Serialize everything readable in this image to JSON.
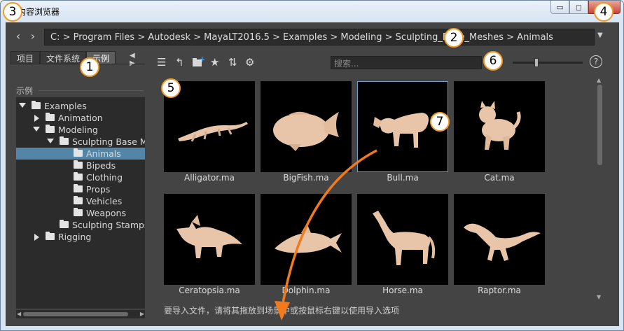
{
  "window": {
    "title": "内容浏览器",
    "buttons": {
      "minimize": "▭",
      "restore": "◻",
      "close": "✕"
    }
  },
  "pathbar": {
    "back_icon": "‹",
    "forward_icon": "›",
    "path": "C:  >  Program Files  >  Autodesk  >  MayaLT2016.5  >  Examples  >  Modeling  >  Sculpting_Base_Meshes  >  Animals",
    "dropdown_icon": "▼"
  },
  "left_panel": {
    "tabs": [
      {
        "label": "项目"
      },
      {
        "label": "文件系统"
      },
      {
        "label": "示例",
        "active": true
      }
    ],
    "tab_arrows": "◀ ▶",
    "section_title": "示例",
    "tree": [
      {
        "label": "Examples",
        "level": 0,
        "expanded": true
      },
      {
        "label": "Animation",
        "level": 1,
        "expanded": false
      },
      {
        "label": "Modeling",
        "level": 1,
        "expanded": true
      },
      {
        "label": "Sculpting Base Meshes",
        "level": 2,
        "expanded": true
      },
      {
        "label": "Animals",
        "level": 3,
        "selected": true
      },
      {
        "label": "Bipeds",
        "level": 3
      },
      {
        "label": "Clothing",
        "level": 3
      },
      {
        "label": "Props",
        "level": 3
      },
      {
        "label": "Vehicles",
        "level": 3
      },
      {
        "label": "Weapons",
        "level": 3
      },
      {
        "label": "Sculpting Stamps",
        "level": 2
      },
      {
        "label": "Rigging",
        "level": 0,
        "expanded": false
      }
    ]
  },
  "toolbar": {
    "icons": [
      "list-view-icon",
      "go-up-icon",
      "new-folder-icon",
      "bookmark-star-icon",
      "sort-icon",
      "settings-gear-icon"
    ],
    "search_placeholder": "搜索...",
    "zoom_level": 0.35,
    "help_label": "?"
  },
  "files": [
    {
      "name": "Alligator.ma"
    },
    {
      "name": "BigFish.ma"
    },
    {
      "name": "Bull.ma",
      "selected": true
    },
    {
      "name": "Cat.ma"
    },
    {
      "name": "Ceratopsia.ma"
    },
    {
      "name": "Dolphin.ma"
    },
    {
      "name": "Horse.ma"
    },
    {
      "name": "Raptor.ma"
    }
  ],
  "status_text": "要导入文件，请将其拖放到场景中或按鼠标右键以使用导入选项",
  "callouts": [
    "1",
    "2",
    "3",
    "4",
    "5",
    "6",
    "7"
  ],
  "colors": {
    "panel": "#444444",
    "field": "#2b2b2b",
    "selection": "#5285a6",
    "callout_border": "#f09a26",
    "arrow": "#f07a1c",
    "model": "#e8c4a8"
  }
}
